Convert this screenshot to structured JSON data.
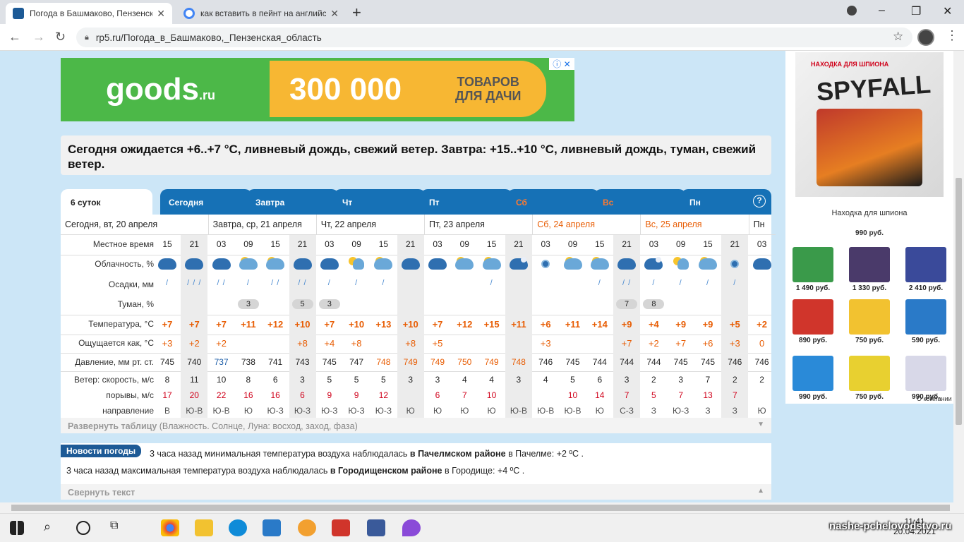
{
  "browser": {
    "tabs": [
      {
        "title": "Погода в Башмаково, Пензенск",
        "active": true
      },
      {
        "title": "как вставить в пейнт на английс",
        "active": false
      }
    ],
    "url": "rp5.ru/Погода_в_Башмаково,_Пензенская_область"
  },
  "ad_banner": {
    "logo": "goods",
    "logo_suffix": ".ru",
    "headline": "300 000",
    "subline_1": "ТОВАРОВ",
    "subline_2": "ДЛЯ ДАЧИ"
  },
  "summary": "Сегодня ожидается +6..+7 °C, ливневый дождь, свежий ветер. Завтра: +15..+10 °C, ливневый дождь, туман, свежий ветер.",
  "forecast_tabs": [
    "6 суток",
    "Сегодня",
    "Завтра",
    "Чт",
    "Пт",
    "Сб",
    "Вс",
    "Пн"
  ],
  "forecast_help": "?",
  "day_headers": [
    "Сегодня, вт, 20 апреля",
    "Завтра, ср, 21 апреля",
    "Чт, 22 апреля",
    "Пт, 23 апреля",
    "Сб, 24 апреля",
    "Вс, 25 апреля",
    "Пн"
  ],
  "row_labels": {
    "time": "Местное время",
    "clouds": "Облачность, %",
    "precip": "Осадки, мм",
    "fog": "Туман, %",
    "temp": "Температура, °C",
    "feels": "Ощущается как, °C",
    "pressure": "Давление, мм рт. ст.",
    "wind": "Ветер: скорость, м/с",
    "gusts": "порывы, м/с",
    "direction": "направление"
  },
  "columns": [
    {
      "time": "15",
      "cloud": "overcast",
      "rain": "light",
      "fog": "",
      "temp": "+7",
      "feels": "+3",
      "pressure": "745",
      "pt": "n",
      "wind": "8",
      "gust": "17",
      "dir": "В"
    },
    {
      "time": "21",
      "cloud": "overcast",
      "rain": "heavy",
      "fog": "",
      "temp": "+7",
      "feels": "+2",
      "pressure": "740",
      "pt": "n",
      "wind": "11",
      "gust": "20",
      "dir": "Ю-В"
    },
    {
      "time": "03",
      "cloud": "overcast",
      "rain": "medium",
      "fog": "",
      "temp": "+7",
      "feels": "+2",
      "pressure": "737",
      "pt": "b",
      "wind": "10",
      "gust": "22",
      "dir": "Ю-В"
    },
    {
      "time": "09",
      "cloud": "sun",
      "rain": "light",
      "fog": "3",
      "temp": "+11",
      "feels": "",
      "pressure": "738",
      "pt": "n",
      "wind": "8",
      "gust": "16",
      "dir": "Ю"
    },
    {
      "time": "15",
      "cloud": "sun",
      "rain": "medium",
      "fog": "",
      "temp": "+12",
      "feels": "",
      "pressure": "741",
      "pt": "n",
      "wind": "6",
      "gust": "16",
      "dir": "Ю-З"
    },
    {
      "time": "21",
      "cloud": "overcast",
      "rain": "medium",
      "fog": "5",
      "temp": "+10",
      "feels": "+8",
      "pressure": "743",
      "pt": "n",
      "wind": "3",
      "gust": "6",
      "dir": "Ю-З"
    },
    {
      "time": "03",
      "cloud": "overcast",
      "rain": "light",
      "fog": "3",
      "temp": "+7",
      "feels": "+4",
      "pressure": "745",
      "pt": "n",
      "wind": "5",
      "gust": "9",
      "dir": "Ю-З"
    },
    {
      "time": "09",
      "cloud": "sunny",
      "rain": "light",
      "fog": "",
      "temp": "+10",
      "feels": "+8",
      "pressure": "747",
      "pt": "n",
      "wind": "5",
      "gust": "9",
      "dir": "Ю-З"
    },
    {
      "time": "15",
      "cloud": "sun",
      "rain": "light",
      "fog": "",
      "temp": "+13",
      "feels": "",
      "pressure": "748",
      "pt": "o",
      "wind": "5",
      "gust": "12",
      "dir": "Ю-З"
    },
    {
      "time": "21",
      "cloud": "overcast",
      "rain": "",
      "fog": "",
      "temp": "+10",
      "feels": "+8",
      "pressure": "749",
      "pt": "o",
      "wind": "3",
      "gust": "",
      "dir": "Ю"
    },
    {
      "time": "03",
      "cloud": "overcast",
      "rain": "",
      "fog": "",
      "temp": "+7",
      "feels": "+5",
      "pressure": "749",
      "pt": "o",
      "wind": "3",
      "gust": "6",
      "dir": "Ю"
    },
    {
      "time": "09",
      "cloud": "sun",
      "rain": "",
      "fog": "",
      "temp": "+12",
      "feels": "",
      "pressure": "750",
      "pt": "o",
      "wind": "4",
      "gust": "7",
      "dir": "Ю"
    },
    {
      "time": "15",
      "cloud": "sun",
      "rain": "light",
      "fog": "",
      "temp": "+15",
      "feels": "",
      "pressure": "749",
      "pt": "o",
      "wind": "4",
      "gust": "10",
      "dir": "Ю"
    },
    {
      "time": "21",
      "cloud": "night",
      "rain": "",
      "fog": "",
      "temp": "+11",
      "feels": "",
      "pressure": "748",
      "pt": "o",
      "wind": "3",
      "gust": "",
      "dir": "Ю-В"
    },
    {
      "time": "03",
      "cloud": "moon",
      "rain": "",
      "fog": "",
      "temp": "+6",
      "feels": "+3",
      "pressure": "746",
      "pt": "n",
      "wind": "4",
      "gust": "",
      "dir": "Ю-В"
    },
    {
      "time": "09",
      "cloud": "sun",
      "rain": "",
      "fog": "",
      "temp": "+11",
      "feels": "",
      "pressure": "745",
      "pt": "n",
      "wind": "5",
      "gust": "10",
      "dir": "Ю-В"
    },
    {
      "time": "15",
      "cloud": "sun",
      "rain": "light",
      "fog": "",
      "temp": "+14",
      "feels": "",
      "pressure": "744",
      "pt": "n",
      "wind": "6",
      "gust": "14",
      "dir": "Ю"
    },
    {
      "time": "21",
      "cloud": "overcast",
      "rain": "medium",
      "fog": "7",
      "temp": "+9",
      "feels": "+7",
      "pressure": "744",
      "pt": "n",
      "wind": "3",
      "gust": "7",
      "dir": "С-З"
    },
    {
      "time": "03",
      "cloud": "night",
      "rain": "light",
      "fog": "8",
      "temp": "+4",
      "feels": "+2",
      "pressure": "744",
      "pt": "n",
      "wind": "2",
      "gust": "5",
      "dir": "З"
    },
    {
      "time": "09",
      "cloud": "sunny",
      "rain": "light",
      "fog": "",
      "temp": "+9",
      "feels": "+7",
      "pressure": "745",
      "pt": "n",
      "wind": "3",
      "gust": "7",
      "dir": "Ю-З"
    },
    {
      "time": "15",
      "cloud": "sun",
      "rain": "light",
      "fog": "",
      "temp": "+9",
      "feels": "+6",
      "pressure": "745",
      "pt": "n",
      "wind": "7",
      "gust": "13",
      "dir": "З"
    },
    {
      "time": "21",
      "cloud": "moon",
      "rain": "light",
      "fog": "",
      "temp": "+5",
      "feels": "+3",
      "pressure": "746",
      "pt": "n",
      "wind": "2",
      "gust": "7",
      "dir": "З"
    },
    {
      "time": "03",
      "cloud": "overcast",
      "rain": "",
      "fog": "",
      "temp": "+2",
      "feels": "0",
      "pressure": "746",
      "pt": "n",
      "wind": "2",
      "gust": "",
      "dir": "Ю"
    }
  ],
  "expand_link": "Развернуть таблицу",
  "expand_hint": "(Влажность. Солнце, Луна: восход, заход, фаза)",
  "news": {
    "badge": "Новости погоды",
    "line1_pre": "3 часа назад минимальная температура воздуха наблюдалась",
    "line1_bold": "в Пачелмском районе",
    "line1_post": "в Пачелме: +2 ºC .",
    "line2_pre": "3 часа назад максимальная температура воздуха наблюдалась",
    "line2_bold": "в Городищенском районе",
    "line2_post": "в Городище: +4 ºC ."
  },
  "collapse_link": "Свернуть текст",
  "side_ad": {
    "main_title": "Находка для шпиона",
    "main_brand": "SPYFALL",
    "main_sub": "НАХОДКА ДЛЯ ШПИОНА",
    "main_price": "990 руб.",
    "items": [
      {
        "price": "1 490 руб.",
        "color": "#3a9a4a"
      },
      {
        "price": "1 330 руб.",
        "color": "#4a3a6a"
      },
      {
        "price": "2 410 руб.",
        "color": "#3a4a9a"
      },
      {
        "price": "890 руб.",
        "color": "#d0352b"
      },
      {
        "price": "750 руб.",
        "color": "#f2c230"
      },
      {
        "price": "590 руб.",
        "color": "#2a7ac8"
      },
      {
        "price": "990 руб.",
        "color": "#2a8ad8"
      },
      {
        "price": "750 руб.",
        "color": "#e8d030"
      },
      {
        "price": "990 руб.",
        "color": "#d8d8e8"
      }
    ],
    "company": "О компании"
  },
  "taskbar": {
    "time": "11:41",
    "date": "20.04.2021"
  },
  "watermark": "nashe-pchelovodstvo.ru",
  "colors": {
    "accent": "#1671b6",
    "weekend": "#e85d04",
    "page_bg": "#cce6f7"
  }
}
